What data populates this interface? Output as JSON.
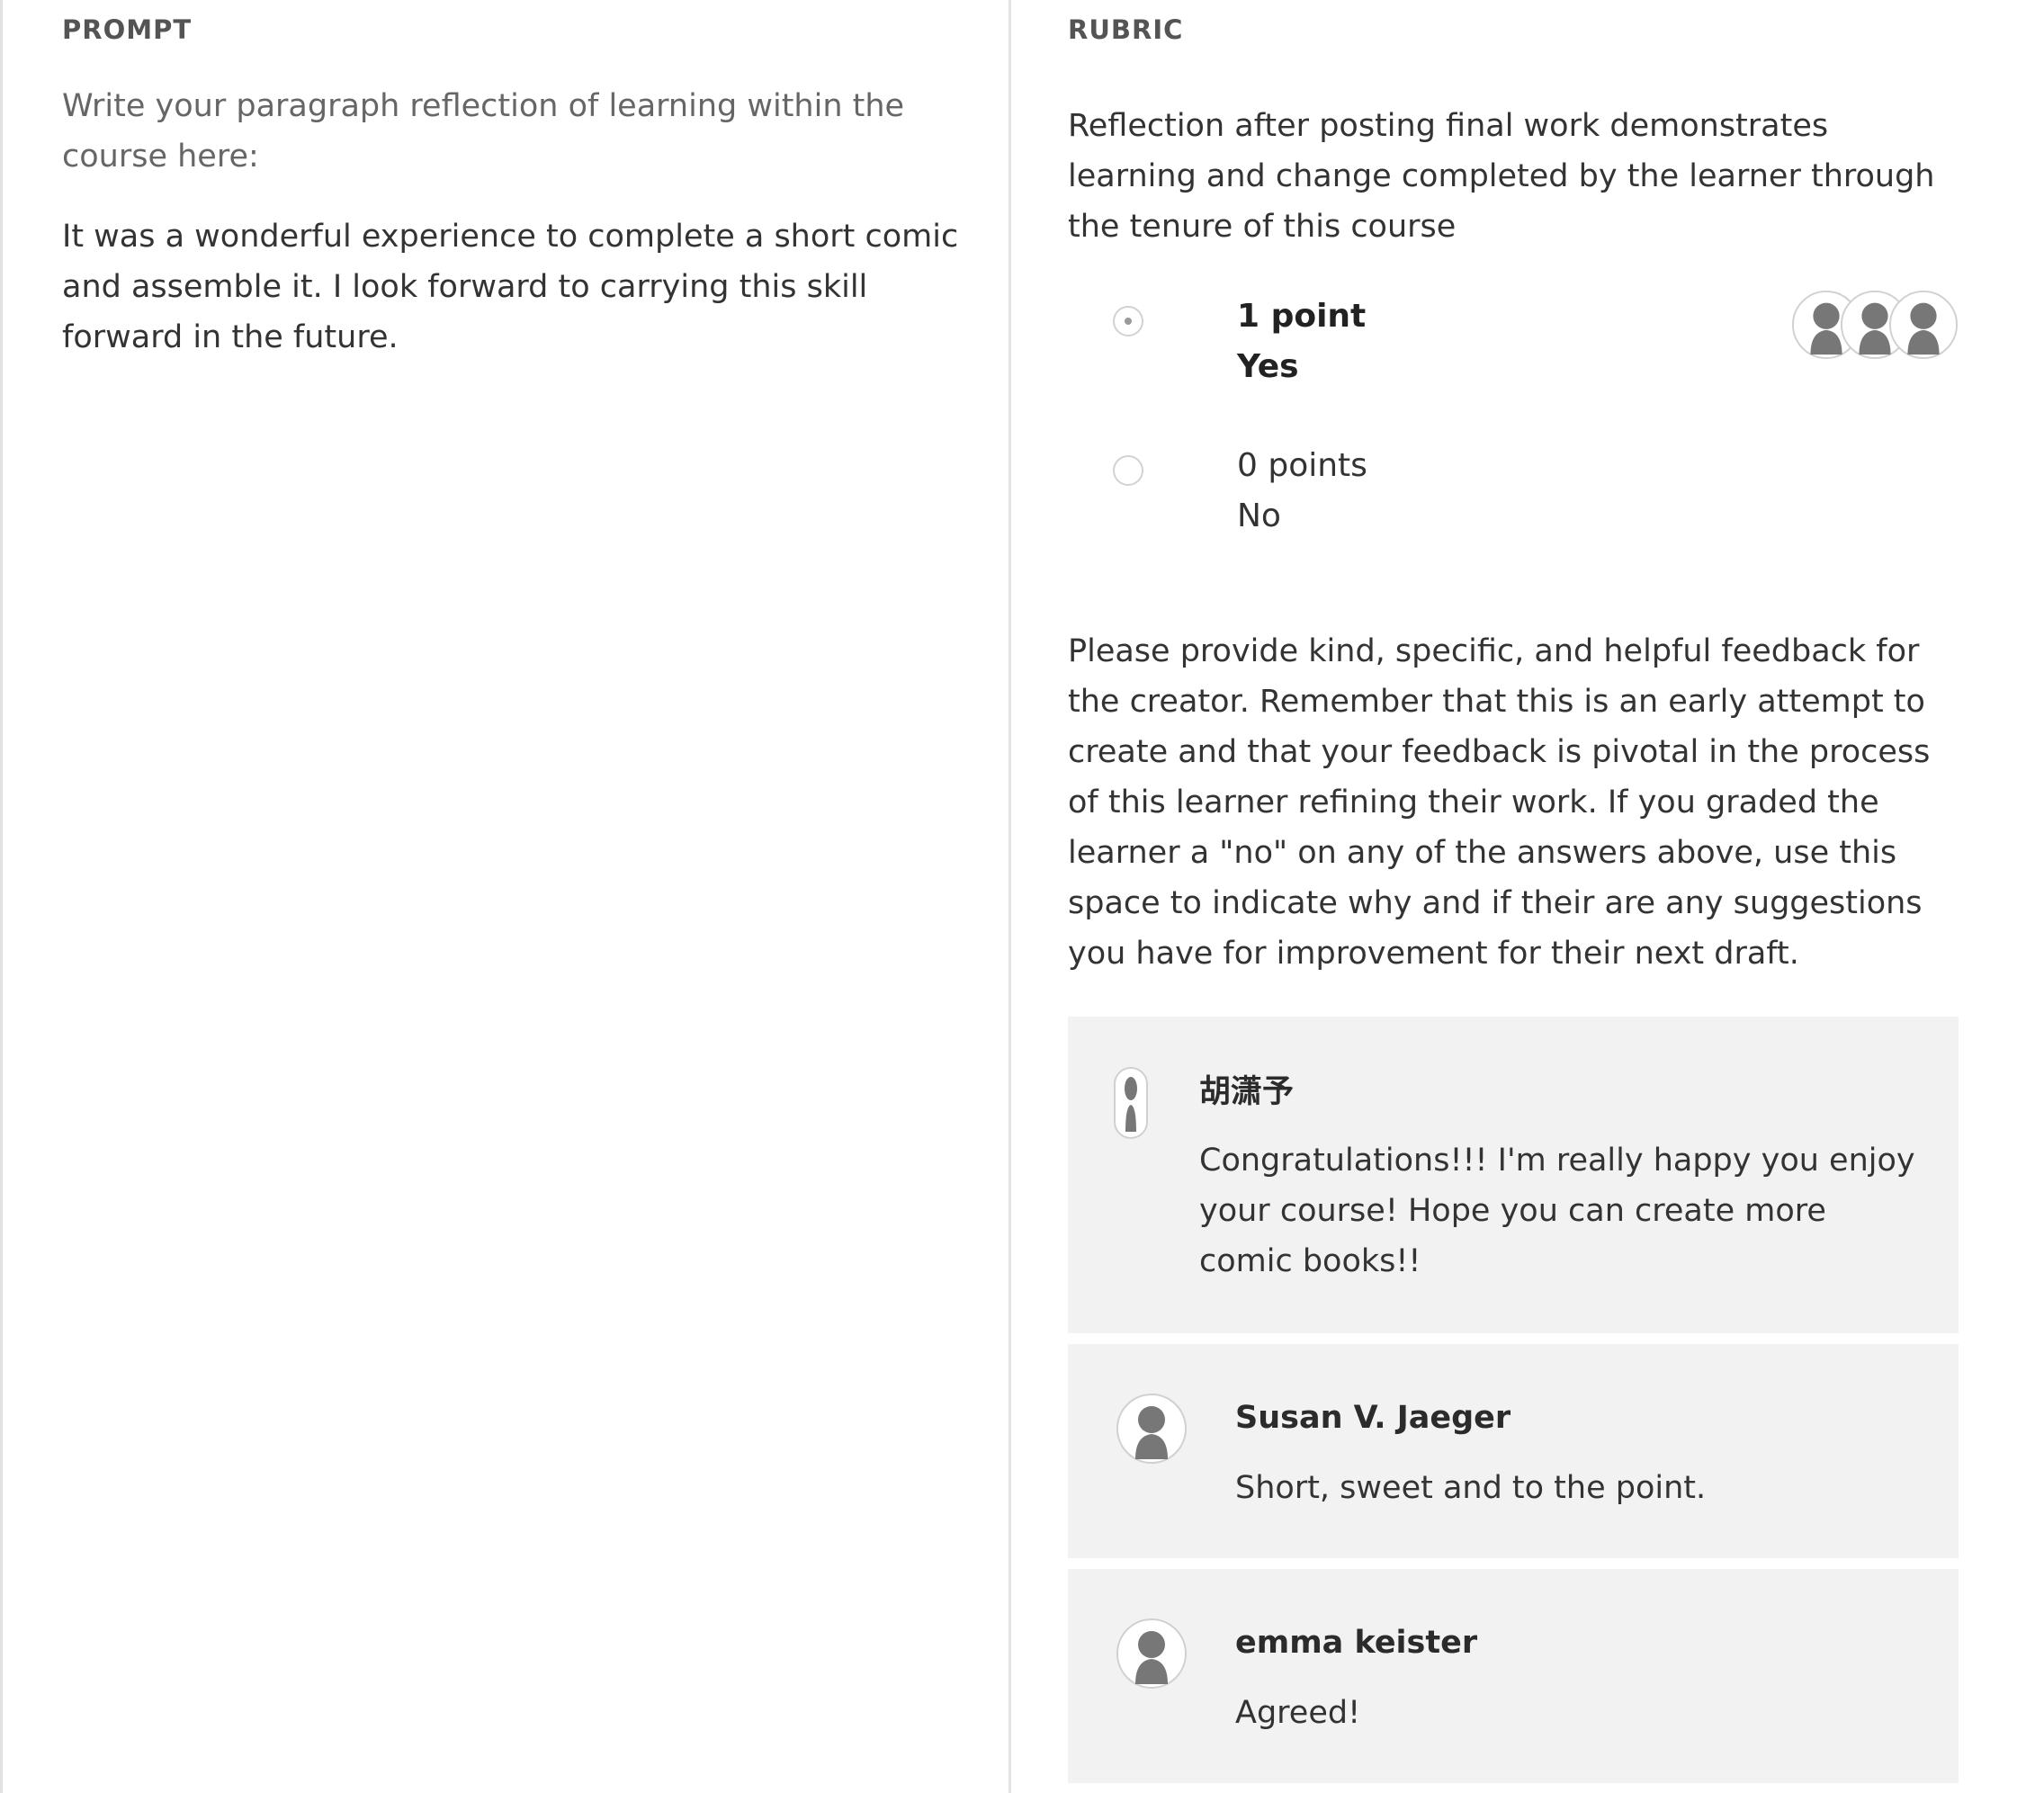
{
  "prompt": {
    "label": "PROMPT",
    "question": "Write your paragraph reflection of learning within the course here:",
    "response": "It was a wonderful experience to complete a short comic and assemble it. I look forward to carrying this skill forward in the future."
  },
  "rubric": {
    "label": "RUBRIC",
    "criterion": "Reflection after posting final work demonstrates learning and change completed by the learner through the tenure of this course",
    "options": [
      {
        "points": "1 point",
        "answer": "Yes",
        "selected": true
      },
      {
        "points": "0 points",
        "answer": "No",
        "selected": false
      }
    ],
    "selection_avatars": [
      "avatar-icon",
      "avatar-icon",
      "avatar-icon"
    ],
    "feedback_instructions": "Please provide kind, specific, and helpful feedback for the creator. Remember that this is an early attempt to create and that your feedback is pivotal in the process of this learner refining their work. If you graded the learner a \"no\" on any of the answers above, use this space to indicate why and if their are any suggestions you have for improvement for their next draft.",
    "comments": [
      {
        "author": "胡潇予",
        "text": "Congratulations!!! I'm really happy you enjoy your course! Hope you can create more comic books!!",
        "avatar": "narrow-avatar-icon"
      },
      {
        "author": "Susan V. Jaeger",
        "text": "Short, sweet and to the point.",
        "avatar": "avatar-icon"
      },
      {
        "author": "emma keister",
        "text": "Agreed!",
        "avatar": "avatar-icon"
      }
    ]
  },
  "colors": {
    "comment_bg": "#f2f2f2",
    "divider": "#e3e3e3",
    "avatar_silhouette": "#777777"
  }
}
